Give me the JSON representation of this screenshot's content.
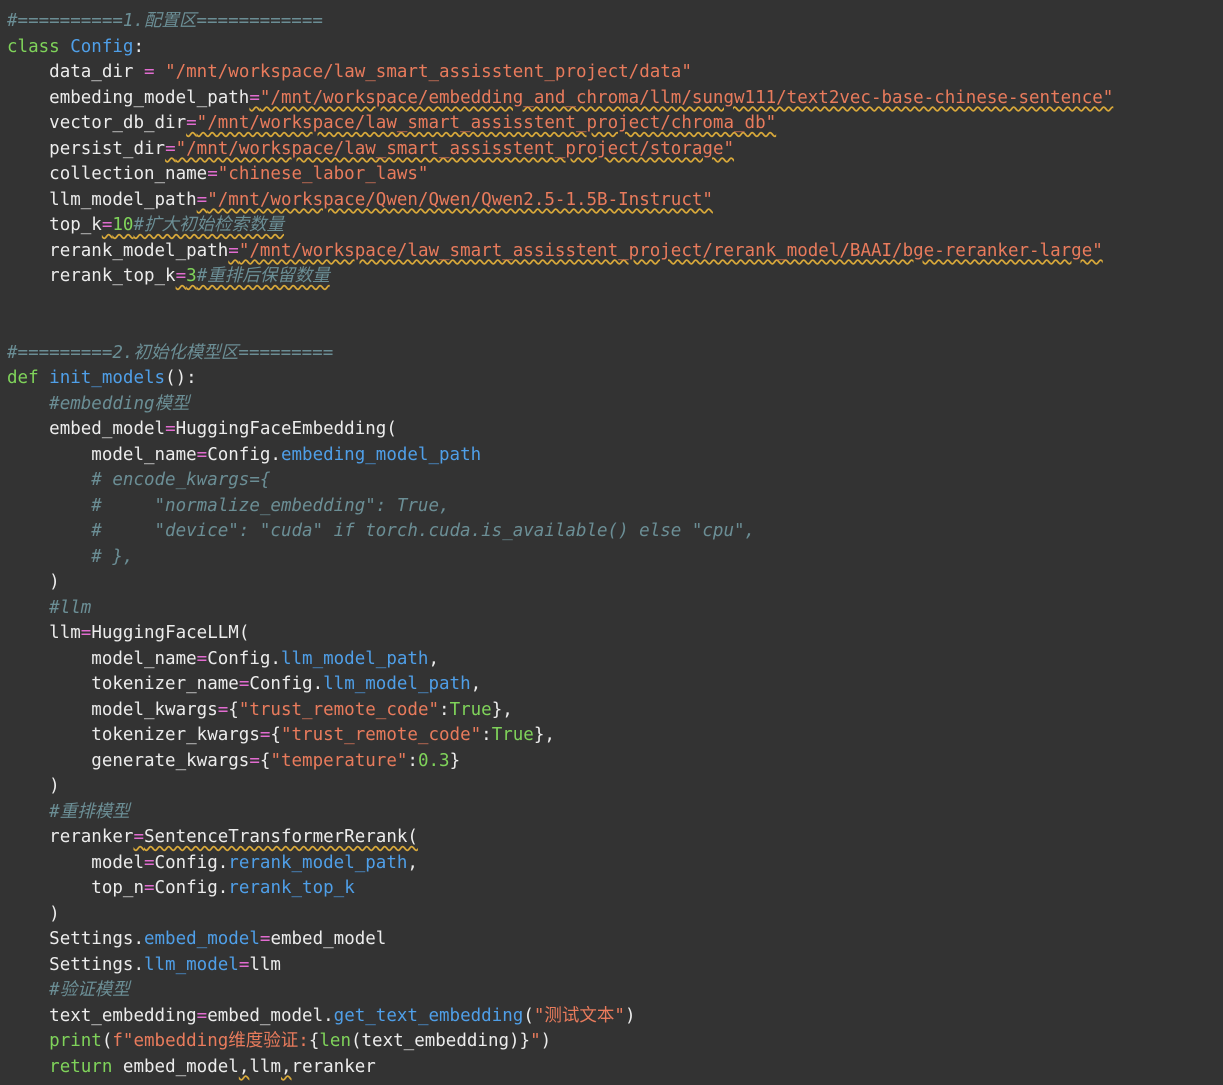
{
  "editor": {
    "lines": [
      [
        {
          "t": "#==========1.配置区============",
          "c": "cmt"
        }
      ],
      [
        {
          "t": "class ",
          "c": "kw"
        },
        {
          "t": "Config",
          "c": "cls"
        },
        {
          "t": ":",
          "c": "plain"
        }
      ],
      [
        {
          "t": "    ",
          "c": "plain"
        },
        {
          "t": "data_dir ",
          "c": "plain"
        },
        {
          "t": "=",
          "c": "op"
        },
        {
          "t": " ",
          "c": "plain"
        },
        {
          "t": "\"/mnt/workspace/law_smart_assisstent_project/data\"",
          "c": "str"
        }
      ],
      [
        {
          "t": "    ",
          "c": "plain"
        },
        {
          "t": "embeding_model_path",
          "c": "plain"
        },
        {
          "t": "=",
          "c": "op warn"
        },
        {
          "t": "\"/mnt/workspace/embedding_and_chroma/llm/sungw111/text2vec-base-chinese-sentence\"",
          "c": "str warn"
        }
      ],
      [
        {
          "t": "    ",
          "c": "plain"
        },
        {
          "t": "vector_db_dir",
          "c": "plain"
        },
        {
          "t": "=",
          "c": "op warn"
        },
        {
          "t": "\"/mnt/workspace/law_smart_assisstent_project/chroma_db\"",
          "c": "str warn"
        }
      ],
      [
        {
          "t": "    ",
          "c": "plain"
        },
        {
          "t": "persist_dir",
          "c": "plain"
        },
        {
          "t": "=",
          "c": "op warn"
        },
        {
          "t": "\"/mnt/workspace/law_smart_assisstent_project/storage\"",
          "c": "str warn"
        }
      ],
      [
        {
          "t": "    ",
          "c": "plain"
        },
        {
          "t": "collection_name",
          "c": "plain"
        },
        {
          "t": "=",
          "c": "op"
        },
        {
          "t": "\"chinese_labor_laws\"",
          "c": "str"
        }
      ],
      [
        {
          "t": "    ",
          "c": "plain"
        },
        {
          "t": "llm_model_path",
          "c": "plain"
        },
        {
          "t": "=",
          "c": "op warn"
        },
        {
          "t": "\"/mnt/workspace/Qwen/Qwen/Qwen2.5-1.5B-Instruct\"",
          "c": "str warn"
        }
      ],
      [
        {
          "t": "    ",
          "c": "plain"
        },
        {
          "t": "top_k",
          "c": "plain"
        },
        {
          "t": "=",
          "c": "op warn"
        },
        {
          "t": "10",
          "c": "num warn"
        },
        {
          "t": "#扩大初始检索数量",
          "c": "cmt warn"
        }
      ],
      [
        {
          "t": "    ",
          "c": "plain"
        },
        {
          "t": "rerank_model_path",
          "c": "plain"
        },
        {
          "t": "=",
          "c": "op warn"
        },
        {
          "t": "\"/mnt/workspace/law_smart_assisstent_project/rerank_model/BAAI/bge-reranker-large\"",
          "c": "str warn"
        }
      ],
      [
        {
          "t": "    ",
          "c": "plain"
        },
        {
          "t": "rerank_top_k",
          "c": "plain"
        },
        {
          "t": "=",
          "c": "op warn"
        },
        {
          "t": "3",
          "c": "num warn"
        },
        {
          "t": "#重排后保留数量",
          "c": "cmt warn"
        }
      ],
      [],
      [],
      [
        {
          "t": "#=========2.初始化模型区=========",
          "c": "cmt"
        }
      ],
      [
        {
          "t": "def ",
          "c": "kw"
        },
        {
          "t": "init_models",
          "c": "fn"
        },
        {
          "t": "():",
          "c": "plain"
        }
      ],
      [
        {
          "t": "    ",
          "c": "plain"
        },
        {
          "t": "#embedding模型",
          "c": "cmt"
        }
      ],
      [
        {
          "t": "    ",
          "c": "plain"
        },
        {
          "t": "embed_model",
          "c": "plain"
        },
        {
          "t": "=",
          "c": "op"
        },
        {
          "t": "HuggingFaceEmbedding(",
          "c": "plain"
        }
      ],
      [
        {
          "t": "        ",
          "c": "plain"
        },
        {
          "t": "model_name",
          "c": "plain"
        },
        {
          "t": "=",
          "c": "op"
        },
        {
          "t": "Config.",
          "c": "plain"
        },
        {
          "t": "embeding_model_path",
          "c": "attr"
        }
      ],
      [
        {
          "t": "        ",
          "c": "plain"
        },
        {
          "t": "# encode_kwargs={",
          "c": "cmt"
        }
      ],
      [
        {
          "t": "        ",
          "c": "plain"
        },
        {
          "t": "#     \"normalize_embedding\": True,",
          "c": "cmt"
        }
      ],
      [
        {
          "t": "        ",
          "c": "plain"
        },
        {
          "t": "#     \"device\": \"cuda\" if torch.cuda.is_available() else \"cpu\",",
          "c": "cmt"
        }
      ],
      [
        {
          "t": "        ",
          "c": "plain"
        },
        {
          "t": "# },",
          "c": "cmt"
        }
      ],
      [
        {
          "t": "    ",
          "c": "plain"
        },
        {
          "t": ")",
          "c": "plain"
        }
      ],
      [
        {
          "t": "    ",
          "c": "plain"
        },
        {
          "t": "#llm",
          "c": "cmt"
        }
      ],
      [
        {
          "t": "    ",
          "c": "plain"
        },
        {
          "t": "llm",
          "c": "plain"
        },
        {
          "t": "=",
          "c": "op"
        },
        {
          "t": "HuggingFaceLLM(",
          "c": "plain"
        }
      ],
      [
        {
          "t": "        ",
          "c": "plain"
        },
        {
          "t": "model_name",
          "c": "plain"
        },
        {
          "t": "=",
          "c": "op"
        },
        {
          "t": "Config.",
          "c": "plain"
        },
        {
          "t": "llm_model_path",
          "c": "attr"
        },
        {
          "t": ",",
          "c": "plain"
        }
      ],
      [
        {
          "t": "        ",
          "c": "plain"
        },
        {
          "t": "tokenizer_name",
          "c": "plain"
        },
        {
          "t": "=",
          "c": "op"
        },
        {
          "t": "Config.",
          "c": "plain"
        },
        {
          "t": "llm_model_path",
          "c": "attr"
        },
        {
          "t": ",",
          "c": "plain"
        }
      ],
      [
        {
          "t": "        ",
          "c": "plain"
        },
        {
          "t": "model_kwargs",
          "c": "plain"
        },
        {
          "t": "=",
          "c": "op"
        },
        {
          "t": "{",
          "c": "plain"
        },
        {
          "t": "\"trust_remote_code\"",
          "c": "str"
        },
        {
          "t": ":",
          "c": "plain"
        },
        {
          "t": "True",
          "c": "kw"
        },
        {
          "t": "},",
          "c": "plain"
        }
      ],
      [
        {
          "t": "        ",
          "c": "plain"
        },
        {
          "t": "tokenizer_kwargs",
          "c": "plain"
        },
        {
          "t": "=",
          "c": "op"
        },
        {
          "t": "{",
          "c": "plain"
        },
        {
          "t": "\"trust_remote_code\"",
          "c": "str"
        },
        {
          "t": ":",
          "c": "plain"
        },
        {
          "t": "True",
          "c": "kw"
        },
        {
          "t": "},",
          "c": "plain"
        }
      ],
      [
        {
          "t": "        ",
          "c": "plain"
        },
        {
          "t": "generate_kwargs",
          "c": "plain"
        },
        {
          "t": "=",
          "c": "op"
        },
        {
          "t": "{",
          "c": "plain"
        },
        {
          "t": "\"temperature\"",
          "c": "str"
        },
        {
          "t": ":",
          "c": "plain"
        },
        {
          "t": "0.3",
          "c": "num"
        },
        {
          "t": "}",
          "c": "plain"
        }
      ],
      [
        {
          "t": "    ",
          "c": "plain"
        },
        {
          "t": ")",
          "c": "plain"
        }
      ],
      [
        {
          "t": "    ",
          "c": "plain"
        },
        {
          "t": "#重排模型",
          "c": "cmt"
        }
      ],
      [
        {
          "t": "    ",
          "c": "plain"
        },
        {
          "t": "reranker",
          "c": "plain"
        },
        {
          "t": "=",
          "c": "op warn"
        },
        {
          "t": "SentenceTransformerRerank(",
          "c": "plain warn"
        }
      ],
      [
        {
          "t": "        ",
          "c": "plain"
        },
        {
          "t": "model",
          "c": "plain"
        },
        {
          "t": "=",
          "c": "op"
        },
        {
          "t": "Config.",
          "c": "plain"
        },
        {
          "t": "rerank_model_path",
          "c": "attr"
        },
        {
          "t": ",",
          "c": "plain"
        }
      ],
      [
        {
          "t": "        ",
          "c": "plain"
        },
        {
          "t": "top_n",
          "c": "plain"
        },
        {
          "t": "=",
          "c": "op"
        },
        {
          "t": "Config.",
          "c": "plain"
        },
        {
          "t": "rerank_top_k",
          "c": "attr"
        }
      ],
      [
        {
          "t": "    ",
          "c": "plain"
        },
        {
          "t": ")",
          "c": "plain"
        }
      ],
      [
        {
          "t": "    ",
          "c": "plain"
        },
        {
          "t": "Settings.",
          "c": "plain"
        },
        {
          "t": "embed_model",
          "c": "attr"
        },
        {
          "t": "=",
          "c": "op"
        },
        {
          "t": "embed_model",
          "c": "plain"
        }
      ],
      [
        {
          "t": "    ",
          "c": "plain"
        },
        {
          "t": "Settings.",
          "c": "plain"
        },
        {
          "t": "llm_model",
          "c": "attr"
        },
        {
          "t": "=",
          "c": "op"
        },
        {
          "t": "llm",
          "c": "plain"
        }
      ],
      [
        {
          "t": "    ",
          "c": "plain"
        },
        {
          "t": "#验证模型",
          "c": "cmt"
        }
      ],
      [
        {
          "t": "    ",
          "c": "plain"
        },
        {
          "t": "text_embedding",
          "c": "plain"
        },
        {
          "t": "=",
          "c": "op"
        },
        {
          "t": "embed_model.",
          "c": "plain"
        },
        {
          "t": "get_text_embedding",
          "c": "fn"
        },
        {
          "t": "(",
          "c": "plain"
        },
        {
          "t": "\"测试文本\"",
          "c": "str"
        },
        {
          "t": ")",
          "c": "plain"
        }
      ],
      [
        {
          "t": "    ",
          "c": "plain"
        },
        {
          "t": "print",
          "c": "kw"
        },
        {
          "t": "(",
          "c": "plain"
        },
        {
          "t": "f\"",
          "c": "str"
        },
        {
          "t": "embedding维度验证:",
          "c": "str"
        },
        {
          "t": "{",
          "c": "plain"
        },
        {
          "t": "len",
          "c": "kw"
        },
        {
          "t": "(text_embedding)}",
          "c": "plain"
        },
        {
          "t": "\"",
          "c": "str"
        },
        {
          "t": ")",
          "c": "plain"
        }
      ],
      [
        {
          "t": "    ",
          "c": "plain"
        },
        {
          "t": "return ",
          "c": "kw"
        },
        {
          "t": "embed_model",
          "c": "plain"
        },
        {
          "t": ",",
          "c": "plain warn"
        },
        {
          "t": "llm",
          "c": "plain"
        },
        {
          "t": ",",
          "c": "plain warn"
        },
        {
          "t": "reranker",
          "c": "plain"
        }
      ]
    ]
  }
}
